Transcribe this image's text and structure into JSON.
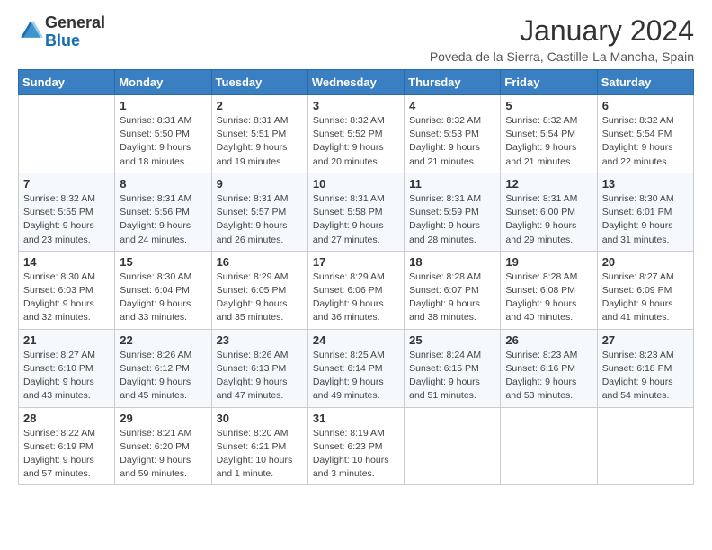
{
  "logo": {
    "general": "General",
    "blue": "Blue"
  },
  "title": "January 2024",
  "subtitle": "Poveda de la Sierra, Castille-La Mancha, Spain",
  "headers": [
    "Sunday",
    "Monday",
    "Tuesday",
    "Wednesday",
    "Thursday",
    "Friday",
    "Saturday"
  ],
  "weeks": [
    [
      {
        "day": "",
        "info": ""
      },
      {
        "day": "1",
        "info": "Sunrise: 8:31 AM\nSunset: 5:50 PM\nDaylight: 9 hours\nand 18 minutes."
      },
      {
        "day": "2",
        "info": "Sunrise: 8:31 AM\nSunset: 5:51 PM\nDaylight: 9 hours\nand 19 minutes."
      },
      {
        "day": "3",
        "info": "Sunrise: 8:32 AM\nSunset: 5:52 PM\nDaylight: 9 hours\nand 20 minutes."
      },
      {
        "day": "4",
        "info": "Sunrise: 8:32 AM\nSunset: 5:53 PM\nDaylight: 9 hours\nand 21 minutes."
      },
      {
        "day": "5",
        "info": "Sunrise: 8:32 AM\nSunset: 5:54 PM\nDaylight: 9 hours\nand 21 minutes."
      },
      {
        "day": "6",
        "info": "Sunrise: 8:32 AM\nSunset: 5:54 PM\nDaylight: 9 hours\nand 22 minutes."
      }
    ],
    [
      {
        "day": "7",
        "info": "Sunrise: 8:32 AM\nSunset: 5:55 PM\nDaylight: 9 hours\nand 23 minutes."
      },
      {
        "day": "8",
        "info": "Sunrise: 8:31 AM\nSunset: 5:56 PM\nDaylight: 9 hours\nand 24 minutes."
      },
      {
        "day": "9",
        "info": "Sunrise: 8:31 AM\nSunset: 5:57 PM\nDaylight: 9 hours\nand 26 minutes."
      },
      {
        "day": "10",
        "info": "Sunrise: 8:31 AM\nSunset: 5:58 PM\nDaylight: 9 hours\nand 27 minutes."
      },
      {
        "day": "11",
        "info": "Sunrise: 8:31 AM\nSunset: 5:59 PM\nDaylight: 9 hours\nand 28 minutes."
      },
      {
        "day": "12",
        "info": "Sunrise: 8:31 AM\nSunset: 6:00 PM\nDaylight: 9 hours\nand 29 minutes."
      },
      {
        "day": "13",
        "info": "Sunrise: 8:30 AM\nSunset: 6:01 PM\nDaylight: 9 hours\nand 31 minutes."
      }
    ],
    [
      {
        "day": "14",
        "info": "Sunrise: 8:30 AM\nSunset: 6:03 PM\nDaylight: 9 hours\nand 32 minutes."
      },
      {
        "day": "15",
        "info": "Sunrise: 8:30 AM\nSunset: 6:04 PM\nDaylight: 9 hours\nand 33 minutes."
      },
      {
        "day": "16",
        "info": "Sunrise: 8:29 AM\nSunset: 6:05 PM\nDaylight: 9 hours\nand 35 minutes."
      },
      {
        "day": "17",
        "info": "Sunrise: 8:29 AM\nSunset: 6:06 PM\nDaylight: 9 hours\nand 36 minutes."
      },
      {
        "day": "18",
        "info": "Sunrise: 8:28 AM\nSunset: 6:07 PM\nDaylight: 9 hours\nand 38 minutes."
      },
      {
        "day": "19",
        "info": "Sunrise: 8:28 AM\nSunset: 6:08 PM\nDaylight: 9 hours\nand 40 minutes."
      },
      {
        "day": "20",
        "info": "Sunrise: 8:27 AM\nSunset: 6:09 PM\nDaylight: 9 hours\nand 41 minutes."
      }
    ],
    [
      {
        "day": "21",
        "info": "Sunrise: 8:27 AM\nSunset: 6:10 PM\nDaylight: 9 hours\nand 43 minutes."
      },
      {
        "day": "22",
        "info": "Sunrise: 8:26 AM\nSunset: 6:12 PM\nDaylight: 9 hours\nand 45 minutes."
      },
      {
        "day": "23",
        "info": "Sunrise: 8:26 AM\nSunset: 6:13 PM\nDaylight: 9 hours\nand 47 minutes."
      },
      {
        "day": "24",
        "info": "Sunrise: 8:25 AM\nSunset: 6:14 PM\nDaylight: 9 hours\nand 49 minutes."
      },
      {
        "day": "25",
        "info": "Sunrise: 8:24 AM\nSunset: 6:15 PM\nDaylight: 9 hours\nand 51 minutes."
      },
      {
        "day": "26",
        "info": "Sunrise: 8:23 AM\nSunset: 6:16 PM\nDaylight: 9 hours\nand 53 minutes."
      },
      {
        "day": "27",
        "info": "Sunrise: 8:23 AM\nSunset: 6:18 PM\nDaylight: 9 hours\nand 54 minutes."
      }
    ],
    [
      {
        "day": "28",
        "info": "Sunrise: 8:22 AM\nSunset: 6:19 PM\nDaylight: 9 hours\nand 57 minutes."
      },
      {
        "day": "29",
        "info": "Sunrise: 8:21 AM\nSunset: 6:20 PM\nDaylight: 9 hours\nand 59 minutes."
      },
      {
        "day": "30",
        "info": "Sunrise: 8:20 AM\nSunset: 6:21 PM\nDaylight: 10 hours\nand 1 minute."
      },
      {
        "day": "31",
        "info": "Sunrise: 8:19 AM\nSunset: 6:23 PM\nDaylight: 10 hours\nand 3 minutes."
      },
      {
        "day": "",
        "info": ""
      },
      {
        "day": "",
        "info": ""
      },
      {
        "day": "",
        "info": ""
      }
    ]
  ]
}
